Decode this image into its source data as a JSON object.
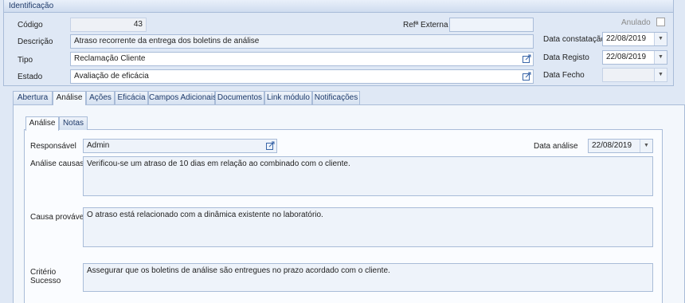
{
  "identificacao": {
    "title": "Identificação",
    "codigo_label": "Código",
    "codigo_value": "43",
    "ref_externa_label": "Refª Externa",
    "ref_externa_value": "",
    "anulado_label": "Anulado",
    "descricao_label": "Descrição",
    "descricao_value": "Atraso recorrente da entrega dos boletins de análise",
    "tipo_label": "Tipo",
    "tipo_value": "Reclamação Cliente",
    "estado_label": "Estado",
    "estado_value": "Avaliação de eficácia",
    "data_constatacao_label": "Data constatação",
    "data_constatacao_value": "22/08/2019",
    "data_registo_label": "Data Registo",
    "data_registo_value": "22/08/2019",
    "data_fecho_label": "Data Fecho",
    "data_fecho_value": ""
  },
  "tabs": [
    {
      "label": "Abertura"
    },
    {
      "label": "Análise"
    },
    {
      "label": "Ações"
    },
    {
      "label": "Eficácia"
    },
    {
      "label": "Campos Adicionais"
    },
    {
      "label": "Documentos"
    },
    {
      "label": "Link módulo"
    },
    {
      "label": "Notificações"
    }
  ],
  "subtabs": [
    {
      "label": "Análise"
    },
    {
      "label": "Notas"
    }
  ],
  "analise": {
    "responsavel_label": "Responsável",
    "responsavel_value": "Admin",
    "data_analise_label": "Data análise",
    "data_analise_value": "22/08/2019",
    "analise_causas_label": "Análise causas",
    "analise_causas_value": "Verificou-se um atraso de 10 dias em relação ao combinado com o cliente.",
    "causa_provavel_label": "Causa provável",
    "causa_provavel_value": "O atraso está relacionado com a dinâmica existente no laboratório.",
    "criterio_sucesso_label_line1": "Critério",
    "criterio_sucesso_label_line2": "Sucesso",
    "criterio_sucesso_value": "Assegurar que os boletins de análise são entregues no prazo acordado com o cliente."
  },
  "icons": {
    "edit": "edit-icon",
    "dropdown": "chevron-down-icon"
  },
  "colors": {
    "background": "#dfe8f5",
    "border": "#a9bcd8",
    "readonly_field": "#eef3fa"
  }
}
